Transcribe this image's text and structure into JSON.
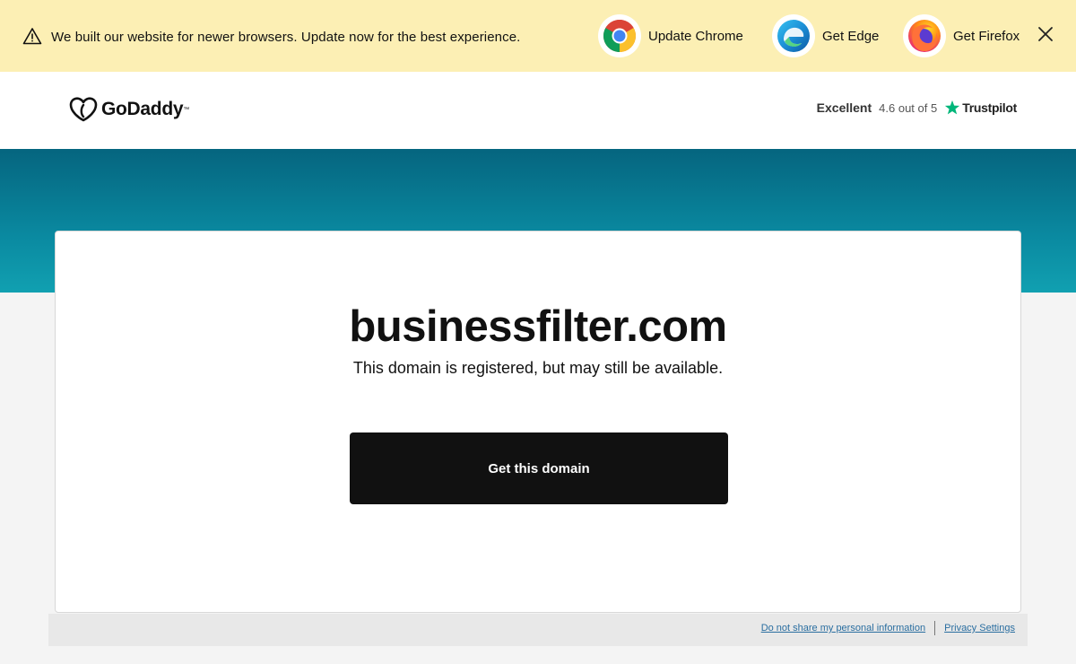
{
  "banner": {
    "message": "We built our website for newer browsers. Update now for the best experience.",
    "chrome_label": "Update Chrome",
    "edge_label": "Get Edge",
    "firefox_label": "Get Firefox"
  },
  "header": {
    "logo_text": "GoDaddy",
    "rating_word": "Excellent",
    "rating_score": "4.6 out of 5",
    "rating_source": "Trustpilot"
  },
  "card": {
    "domain": "businessfilter.com",
    "subtitle": "This domain is registered, but may still be available.",
    "cta_label": "Get this domain"
  },
  "footer": {
    "do_not_share": "Do not share my personal information",
    "privacy_settings": "Privacy Settings"
  },
  "colors": {
    "banner_bg": "#fcefb4",
    "teal": "#0a89a0",
    "cta_bg": "#111111",
    "trustpilot_green": "#00b67a"
  }
}
